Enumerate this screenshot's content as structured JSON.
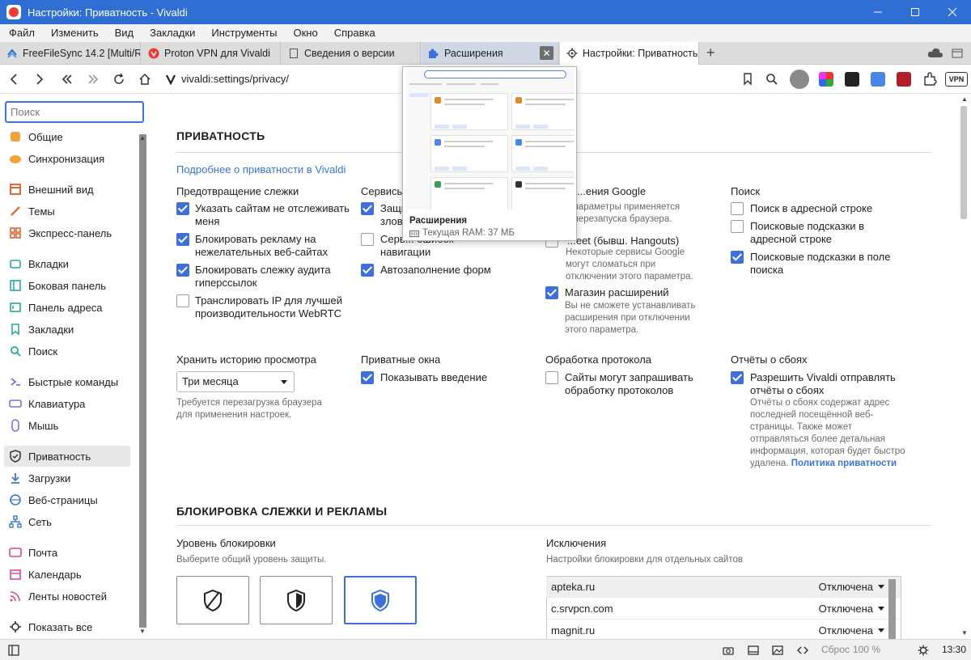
{
  "window": {
    "title": "Настройки: Приватность - Vivaldi"
  },
  "menu": [
    "Файл",
    "Изменить",
    "Вид",
    "Закладки",
    "Инструменты",
    "Окно",
    "Справка"
  ],
  "tabs": [
    {
      "label": "FreeFileSync 14.2 [Multi/Ru]"
    },
    {
      "label": "Proton VPN для Vivaldi"
    },
    {
      "label": "Сведения о версии"
    },
    {
      "label": "Расширения"
    },
    {
      "label": "Настройки: Приватность"
    }
  ],
  "tab_close": "✕",
  "new_tab": "+",
  "address": {
    "url": "vivaldi:settings/privacy/",
    "vpn_label": "VPN"
  },
  "sidebar": {
    "search_placeholder": "Поиск",
    "items": [
      "Общие",
      "Синхронизация",
      "Внешний вид",
      "Темы",
      "Экспресс-панель",
      "Вкладки",
      "Боковая панель",
      "Панель адреса",
      "Закладки",
      "Поиск",
      "Быстрые команды",
      "Клавиатура",
      "Мышь",
      "Приватность",
      "Загрузки",
      "Веб-страницы",
      "Сеть",
      "Почта",
      "Календарь",
      "Ленты новостей",
      "Показать все"
    ]
  },
  "privacy": {
    "title": "ПРИВАТНОСТЬ",
    "more_link": "Подробнее о приватности в Vivaldi",
    "tracking": {
      "header": "Предотвращение слежки",
      "items": [
        {
          "label": "Указать сайтам не отслеживать меня",
          "checked": true
        },
        {
          "label": "Блокировать рекламу на нежелательных веб-сайтах",
          "checked": true
        },
        {
          "label": "Блокировать слежку аудита гиперссылок",
          "checked": true
        },
        {
          "label": "Транслировать IP для лучшей производительности WebRTC",
          "checked": false
        }
      ]
    },
    "services": {
      "header": "Сервисы",
      "items": [
        {
          "label": "Защи... злов...",
          "checked": true
        },
        {
          "label": "Серв... ошибок навигации",
          "checked": false
        },
        {
          "label": "Автозаполнение форм",
          "checked": true
        }
      ]
    },
    "google": {
      "header": "...ения Google",
      "note": "...параметры применяется ...перезапуска браузера.",
      "items": [
        {
          "label": "...eet (бывш. Hangouts)",
          "sub": "Некоторые сервисы Google могут сломаться при отключении этого параметра.",
          "checked": false
        },
        {
          "label": "Магазин расширений",
          "sub": "Вы не сможете устанавливать расширения при отключении этого параметра.",
          "checked": true
        }
      ]
    },
    "search": {
      "header": "Поиск",
      "items": [
        {
          "label": "Поиск в адресной строке",
          "checked": false
        },
        {
          "label": "Поисковые подсказки в адресной строке",
          "checked": false
        },
        {
          "label": "Поисковые подсказки в поле поиска",
          "checked": true
        }
      ]
    },
    "history": {
      "header": "Хранить историю просмотра",
      "value": "Три месяца",
      "note": "Требуется перезагрузка браузера для применения настроек."
    },
    "private_windows": {
      "header": "Приватные окна",
      "item": "Показывать введение",
      "checked": true
    },
    "protocol": {
      "header": "Обработка протокола",
      "item": "Сайты могут запрашивать обработку протоколов",
      "checked": false
    },
    "crash": {
      "header": "Отчёты о сбоях",
      "item": "Разрешить Vivaldi отправлять отчёты о сбоях",
      "checked": true,
      "note": "Отчёты о сбоях содержат адрес последней посещённой веб-страницы. Также может отправляться более детальная информация, которая будет быстро удалена.",
      "link": "Политика приватности"
    }
  },
  "blocking": {
    "title": "БЛОКИРОВКА СЛЕЖКИ И РЕКЛАМЫ",
    "level_header": "Уровень блокировки",
    "level_note": "Выберите общий уровень защиты.",
    "exceptions_header": "Исключения",
    "exceptions_note": "Настройки блокировки для отдельных сайтов",
    "exceptions": [
      {
        "site": "apteka.ru",
        "status": "Отключена"
      },
      {
        "site": "c.srvpcn.com",
        "status": "Отключена"
      },
      {
        "site": "magnit.ru",
        "status": "Отключена"
      }
    ]
  },
  "popup": {
    "title": "Расширения",
    "ram": "Текущая RAM: 37 МБ"
  },
  "status": {
    "reset": "Сброс",
    "zoom": "100 %",
    "time": "13:30"
  },
  "colors": {
    "accent": "#3f6fd8",
    "titlebar": "#2f6fd3",
    "link": "#3a73d4"
  }
}
